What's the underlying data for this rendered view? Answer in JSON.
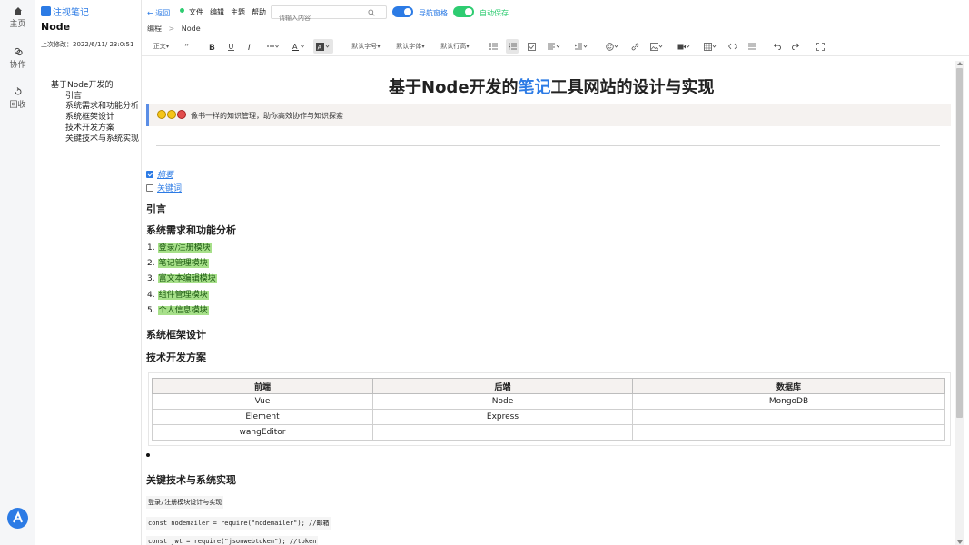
{
  "rail": {
    "items": [
      {
        "label": "主页",
        "icon": "home-icon"
      },
      {
        "label": "协作",
        "icon": "collab-icon"
      },
      {
        "label": "回收",
        "icon": "recycle-icon"
      }
    ]
  },
  "sidebar": {
    "brand": "注视笔记",
    "doc_title": "Node",
    "last_modified": "上次修改：2022/6/11/ 23:0:51",
    "outline": [
      {
        "level": 1,
        "label": "基于Node开发的"
      },
      {
        "level": 2,
        "label": "引言"
      },
      {
        "level": 2,
        "label": "系统需求和功能分析"
      },
      {
        "level": 2,
        "label": "系统框架设计"
      },
      {
        "level": 2,
        "label": "技术开发方案"
      },
      {
        "level": 2,
        "label": "关键技术与系统实现"
      }
    ]
  },
  "topbar": {
    "back": "← 返回",
    "menus": [
      "文件",
      "编辑",
      "主题",
      "帮助"
    ],
    "search_placeholder": "请输入内容",
    "toggle_nav": "导航窗格",
    "toggle_autosave": "自动保存",
    "accent": "#2c7be5",
    "green": "#2ecc71"
  },
  "breadcrumb": {
    "root": "编程",
    "sep": ">",
    "current": "Node"
  },
  "toolbar": {
    "paragraph": "正文",
    "font_size": "默认字号",
    "font_family": "默认字体",
    "line_height": "默认行高"
  },
  "doc": {
    "title_pre": "基于Node开发的",
    "title_hl": "笔记",
    "title_post": "工具网站的设计与实现",
    "quote": "像书一样的知识管理，助你高效协作与知识探索",
    "tasks": [
      {
        "label": "摘要",
        "checked": true
      },
      {
        "label": "关键词",
        "checked": false
      }
    ],
    "h_intro": "引言",
    "h_req": "系统需求和功能分析",
    "modules": [
      "登录/注册模块",
      "笔记管理模块",
      "富文本编辑模块",
      "组件管理模块",
      "个人信息模块"
    ],
    "h_arch": "系统框架设计",
    "h_tech": "技术开发方案",
    "table": {
      "headers": [
        "前端",
        "后端",
        "数据库"
      ],
      "rows": [
        [
          "Vue",
          "Node",
          "MongoDB"
        ],
        [
          "Element",
          "Express",
          ""
        ],
        [
          "wangEditor",
          "",
          ""
        ]
      ]
    },
    "h_key": "关键技术与系统实现",
    "code_lines": [
      "登录/注册模块设计与实现",
      "const nodemailer = require(\"nodemailer\"); //邮箱",
      "const jwt = require(\"jsonwebtoken\"); //token"
    ]
  }
}
